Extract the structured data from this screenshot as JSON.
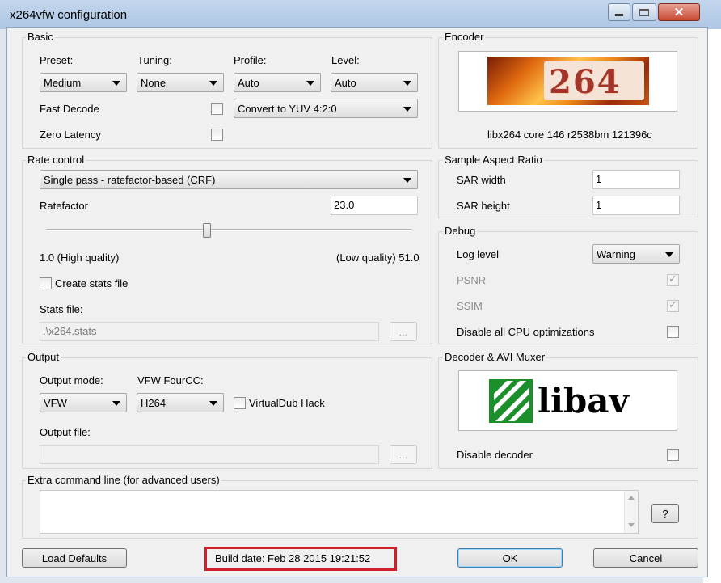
{
  "window": {
    "title": "x264vfw configuration"
  },
  "basic": {
    "group_label": "Basic",
    "preset": {
      "label": "Preset:",
      "value": "Medium"
    },
    "tuning": {
      "label": "Tuning:",
      "value": "None"
    },
    "profile": {
      "label": "Profile:",
      "value": "Auto"
    },
    "level": {
      "label": "Level:",
      "value": "Auto"
    },
    "fast_decode": {
      "label": "Fast Decode",
      "checked": false
    },
    "zero_latency": {
      "label": "Zero Latency",
      "checked": false
    },
    "colorspace": {
      "value": "Convert to YUV 4:2:0"
    }
  },
  "encoder": {
    "group_label": "Encoder",
    "logo_text": "264",
    "version": "libx264 core 146 r2538bm 121396c"
  },
  "rate_control": {
    "group_label": "Rate control",
    "mode": "Single pass - ratefactor-based (CRF)",
    "ratefactor": {
      "label": "Ratefactor",
      "value": "23.0",
      "slider_fraction": 0.44
    },
    "min_label": "1.0 (High quality)",
    "max_label": "(Low quality) 51.0",
    "create_stats": {
      "label": "Create stats file",
      "checked": false
    },
    "stats_file": {
      "label": "Stats file:",
      "value": ".\\x264.stats",
      "browse": "..."
    }
  },
  "sar": {
    "group_label": "Sample Aspect Ratio",
    "width": {
      "label": "SAR width",
      "value": "1"
    },
    "height": {
      "label": "SAR height",
      "value": "1"
    }
  },
  "debug": {
    "group_label": "Debug",
    "log_level": {
      "label": "Log level",
      "value": "Warning"
    },
    "psnr": {
      "label": "PSNR",
      "checked": true
    },
    "ssim": {
      "label": "SSIM",
      "checked": true
    },
    "disable_cpu": {
      "label": "Disable all CPU optimizations",
      "checked": false
    }
  },
  "output": {
    "group_label": "Output",
    "mode": {
      "label": "Output mode:",
      "value": "VFW"
    },
    "fourcc": {
      "label": "VFW FourCC:",
      "value": "H264"
    },
    "virtualdub_hack": {
      "label": "VirtualDub Hack",
      "checked": false
    },
    "file": {
      "label": "Output file:",
      "value": "",
      "browse": "..."
    }
  },
  "decoder": {
    "group_label": "Decoder & AVI Muxer",
    "logo_text": "libav",
    "disable_decoder": {
      "label": "Disable decoder",
      "checked": false
    }
  },
  "extra": {
    "group_label": "Extra command line (for advanced users)",
    "value": "",
    "help": "?"
  },
  "footer": {
    "load_defaults": "Load Defaults",
    "build_date": "Build date: Feb 28 2015 19:21:52",
    "ok": "OK",
    "cancel": "Cancel"
  },
  "colors": {
    "highlight_border": "#d0202a",
    "titlebar": "#aec6e4",
    "dialog_bg": "#f0f0f0"
  }
}
